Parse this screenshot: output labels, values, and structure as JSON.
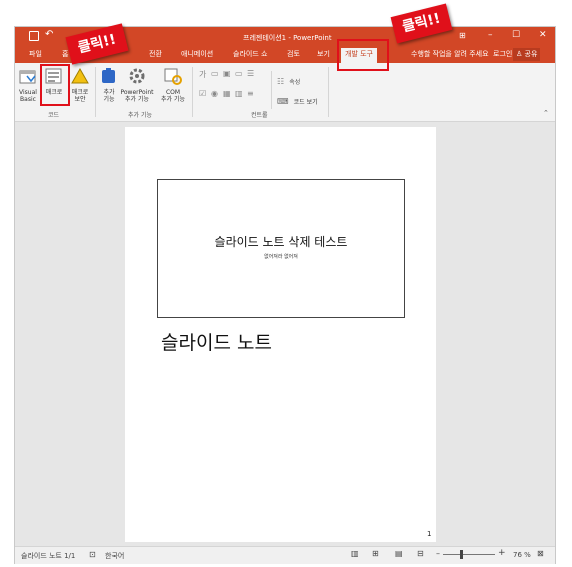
{
  "window": {
    "title": "프레젠테이션1 - PowerPoint",
    "controls": {
      "ribbon_opts": "⊞",
      "minimize": "–",
      "maximize": "☐",
      "close": "✕"
    }
  },
  "qat": {
    "save_icon": "save-icon",
    "undo_glyph": "↶"
  },
  "tabs": [
    {
      "label": "파일"
    },
    {
      "label": "홈"
    },
    {
      "label": "전환"
    },
    {
      "label": "애니메이션"
    },
    {
      "label": "슬라이드 쇼"
    },
    {
      "label": "검토"
    },
    {
      "label": "보기"
    },
    {
      "label": "개발 도구"
    }
  ],
  "tellme": "수행할 작업을 알려 주세요",
  "account": {
    "signin": "로그인",
    "share": "공유"
  },
  "ribbon": {
    "code_group": {
      "label": "코드",
      "visual_basic": [
        "Visual",
        "Basic"
      ],
      "macro": "매크로",
      "macro_security": [
        "매크로",
        "보안"
      ]
    },
    "addins_group": {
      "label": "추가 기능",
      "addins": [
        "추가",
        "기능"
      ],
      "ppt_addins": [
        "PowerPoint",
        "추가 기능"
      ],
      "com_addins": [
        "COM",
        "추가 기능"
      ]
    },
    "controls_group": {
      "label": "컨트롤",
      "properties": "속성",
      "view_code": "코드 보기"
    }
  },
  "callouts": {
    "left": "클릭!!",
    "right": "클릭!!"
  },
  "slide": {
    "title": "슬라이드 노트 삭제 테스트",
    "subtitle": "없어져라 없어져",
    "notes": "슬라이드 노트",
    "page_number": "1"
  },
  "status": {
    "slide_info": "슬라이드 노트 1/1",
    "language": "한국어",
    "zoom": "76 %"
  },
  "colors": {
    "accent": "#d24726",
    "callout": "#e0101a"
  }
}
